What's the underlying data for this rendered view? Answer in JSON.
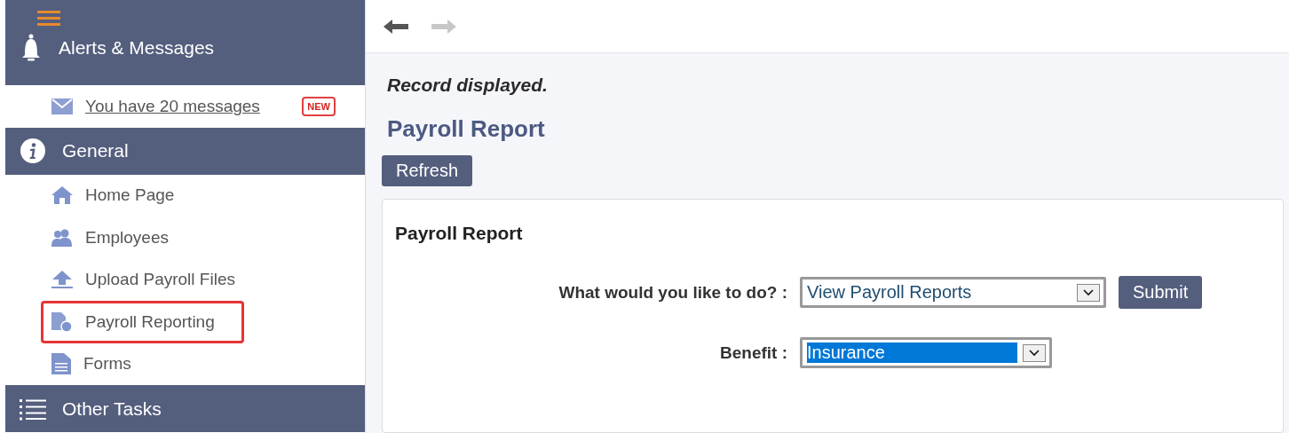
{
  "sidebar": {
    "sections": [
      {
        "kind": "alerts",
        "title": "Alerts & Messages",
        "items": [
          {
            "kind": "mail",
            "label": "You have 20 messages",
            "badge": "NEW",
            "selected": false
          }
        ]
      },
      {
        "kind": "info",
        "title": "General",
        "items": [
          {
            "kind": "home",
            "label": "Home Page",
            "selected": false
          },
          {
            "kind": "people",
            "label": "Employees",
            "selected": false
          },
          {
            "kind": "upload",
            "label": "Upload Payroll Files",
            "selected": false
          },
          {
            "kind": "report",
            "label": "Payroll Reporting",
            "selected": true
          },
          {
            "kind": "forms",
            "label": "Forms",
            "selected": false
          }
        ]
      },
      {
        "kind": "list",
        "title": "Other Tasks"
      }
    ]
  },
  "nav": {
    "back_disabled": false,
    "forward_disabled": true
  },
  "message": "Record displayed.",
  "page_title": "Payroll Report",
  "refresh_button": "Refresh",
  "card": {
    "title": "Payroll Report",
    "fields": [
      {
        "label": "What would you like to do? :",
        "value": "View Payroll Reports",
        "highlighted": false,
        "button": "Submit"
      },
      {
        "label": "Benefit :",
        "value": "Insurance",
        "highlighted": true
      }
    ]
  }
}
